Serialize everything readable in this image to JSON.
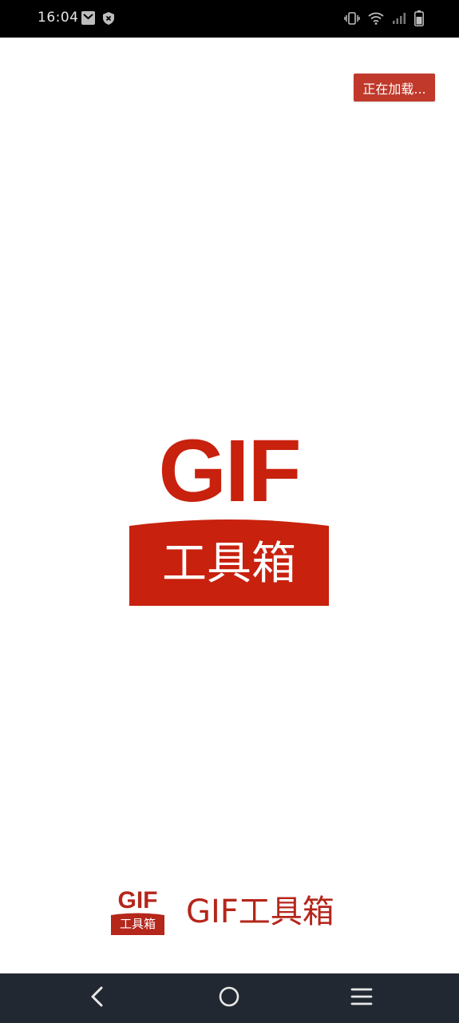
{
  "status_bar": {
    "time": "16:04",
    "left_icons": [
      "gmail-icon",
      "shield-icon"
    ],
    "right_icons": [
      "vibrate-icon",
      "wifi-icon",
      "signal-icon",
      "battery-icon"
    ]
  },
  "loading_badge": {
    "text": "正在加载..."
  },
  "splash_logo": {
    "gif_text": "GIF",
    "box_text": "工具箱"
  },
  "footer_brand": {
    "logo_gif_text": "GIF",
    "logo_box_text": "工具箱",
    "title": "GIF工具箱"
  },
  "nav_bar": {
    "buttons": [
      "back-icon",
      "home-icon",
      "menu-icon"
    ]
  },
  "colors": {
    "brand_red": "#c8210e",
    "badge_red": "#c0392b",
    "footer_red": "#b5261b",
    "nav_bg": "#222831",
    "status_bg": "#000000"
  }
}
